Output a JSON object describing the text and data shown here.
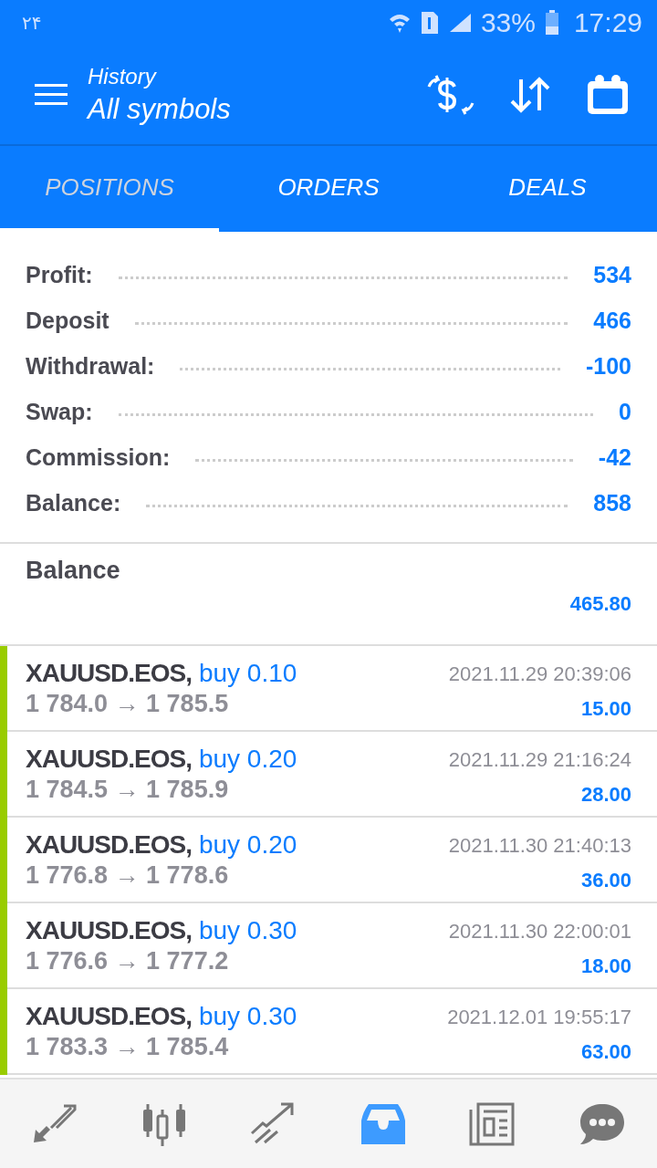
{
  "status_bar": {
    "date": "۲۴",
    "battery": "33%",
    "time": "17:29"
  },
  "header": {
    "title": "History",
    "subtitle": "All symbols"
  },
  "tabs": [
    {
      "label": "POSITIONS",
      "selected": true
    },
    {
      "label": "ORDERS",
      "selected": false
    },
    {
      "label": "DEALS",
      "selected": false
    }
  ],
  "summary": [
    {
      "label": "Profit:",
      "value": "534"
    },
    {
      "label": "Deposit",
      "value": "466"
    },
    {
      "label": "Withdrawal:",
      "value": "-100"
    },
    {
      "label": "Swap:",
      "value": "0"
    },
    {
      "label": "Commission:",
      "value": "-42"
    },
    {
      "label": "Balance:",
      "value": "858"
    }
  ],
  "balance": {
    "label": "Balance",
    "value": "465.80"
  },
  "positions": [
    {
      "symbol": "XAUUSD.EOS,",
      "trade": "buy 0.10",
      "prices": "1 784.0 → 1 785.5",
      "time": "2021.11.29 20:39:06",
      "profit": "15.00",
      "color": "#99cc00"
    },
    {
      "symbol": "XAUUSD.EOS,",
      "trade": "buy 0.20",
      "prices": "1 784.5 → 1 785.9",
      "time": "2021.11.29 21:16:24",
      "profit": "28.00",
      "color": "#99cc00"
    },
    {
      "symbol": "XAUUSD.EOS,",
      "trade": "buy 0.20",
      "prices": "1 776.8 → 1 778.6",
      "time": "2021.11.30 21:40:13",
      "profit": "36.00",
      "color": "#99cc00"
    },
    {
      "symbol": "XAUUSD.EOS,",
      "trade": "buy 0.30",
      "prices": "1 776.6 → 1 777.2",
      "time": "2021.11.30 22:00:01",
      "profit": "18.00",
      "color": "#99cc00"
    },
    {
      "symbol": "XAUUSD.EOS,",
      "trade": "buy 0.30",
      "prices": "1 783.3 → 1 785.4",
      "time": "2021.12.01 19:55:17",
      "profit": "63.00",
      "color": "#99cc00"
    }
  ],
  "bottom_nav": [
    {
      "kind": "quotes",
      "selected": false
    },
    {
      "kind": "chart",
      "selected": false
    },
    {
      "kind": "trade",
      "selected": false
    },
    {
      "kind": "history",
      "selected": true
    },
    {
      "kind": "news",
      "selected": false
    },
    {
      "kind": "chat",
      "selected": false
    }
  ]
}
